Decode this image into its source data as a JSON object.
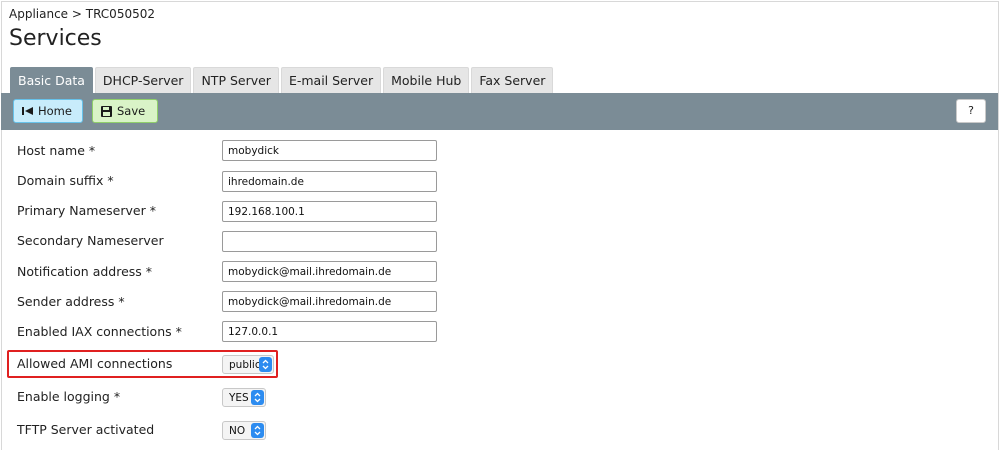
{
  "breadcrumb": "Appliance > TRC050502",
  "page_title": "Services",
  "tabs": [
    {
      "label": "Basic Data",
      "active": true
    },
    {
      "label": "DHCP-Server",
      "active": false
    },
    {
      "label": "NTP Server",
      "active": false
    },
    {
      "label": "E-mail Server",
      "active": false
    },
    {
      "label": "Mobile Hub",
      "active": false
    },
    {
      "label": "Fax Server",
      "active": false
    }
  ],
  "toolbar": {
    "home_label": "Home",
    "save_label": "Save",
    "help_label": "?"
  },
  "form": {
    "host_name": {
      "label": "Host name *",
      "value": "mobydick"
    },
    "domain_suffix": {
      "label": "Domain suffix *",
      "value": "ihredomain.de"
    },
    "primary_ns": {
      "label": "Primary Nameserver *",
      "value": "192.168.100.1"
    },
    "secondary_ns": {
      "label": "Secondary Nameserver",
      "value": ""
    },
    "notification": {
      "label": "Notification address *",
      "value": "mobydick@mail.ihredomain.de"
    },
    "sender": {
      "label": "Sender address *",
      "value": "mobydick@mail.ihredomain.de"
    },
    "iax": {
      "label": "Enabled IAX connections *",
      "value": "127.0.0.1"
    },
    "ami": {
      "label": "Allowed AMI connections",
      "value": "public"
    },
    "logging": {
      "label": "Enable logging *",
      "value": "YES"
    },
    "tftp": {
      "label": "TFTP Server activated",
      "value": "NO"
    }
  },
  "colors": {
    "toolbar_bg": "#7b8c96",
    "highlight": "#e02020",
    "select_accent": "#2d8cf0"
  },
  "icons": {
    "home": "home-first-icon",
    "save": "floppy-disk-icon",
    "select": "chevron-updown-icon"
  }
}
